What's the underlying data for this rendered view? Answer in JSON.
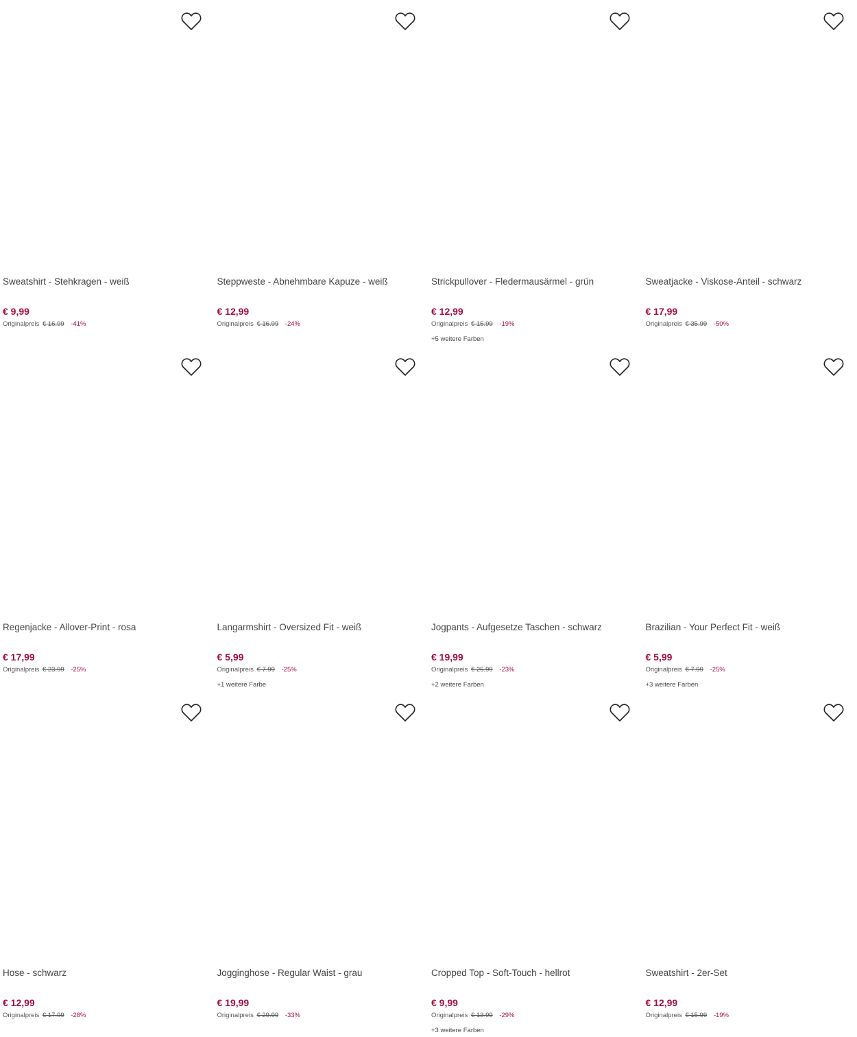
{
  "accent_color": "#a0103c",
  "wishlist_icon": "heart-outline-icon",
  "products": [
    {
      "title": "Sweatshirt - Stehkragen - weiß",
      "price": "€ 9,99",
      "orig_label": "Originalpreis",
      "orig_price": "€ 16.99",
      "discount": "-41%",
      "colors": ""
    },
    {
      "title": "Steppweste - Abnehmbare Kapuze - weiß",
      "price": "€ 12,99",
      "orig_label": "Originalpreis",
      "orig_price": "€ 16.99",
      "discount": "-24%",
      "colors": ""
    },
    {
      "title": "Strickpullover - Fledermausärmel - grün",
      "price": "€ 12,99",
      "orig_label": "Originalpreis",
      "orig_price": "€ 15.99",
      "discount": "-19%",
      "colors": "+5 weitere Farben"
    },
    {
      "title": "Sweatjacke - Viskose-Anteil - schwarz",
      "price": "€ 17,99",
      "orig_label": "Originalpreis",
      "orig_price": "€ 35.99",
      "discount": "-50%",
      "colors": ""
    },
    {
      "title": "Regenjacke - Allover-Print - rosa",
      "price": "€ 17,99",
      "orig_label": "Originalpreis",
      "orig_price": "€ 23.99",
      "discount": "-25%",
      "colors": ""
    },
    {
      "title": "Langarmshirt - Oversized Fit - weiß",
      "price": "€ 5,99",
      "orig_label": "Originalpreis",
      "orig_price": "€ 7.99",
      "discount": "-25%",
      "colors": "+1 weitere Farbe"
    },
    {
      "title": "Jogpants - Aufgesetze Taschen - schwarz",
      "price": "€ 19,99",
      "orig_label": "Originalpreis",
      "orig_price": "€ 25.99",
      "discount": "-23%",
      "colors": "+2 weitere Farben"
    },
    {
      "title": "Brazilian - Your Perfect Fit - weiß",
      "price": "€ 5,99",
      "orig_label": "Originalpreis",
      "orig_price": "€ 7.99",
      "discount": "-25%",
      "colors": "+3 weitere Farben"
    },
    {
      "title": "Hose - schwarz",
      "price": "€ 12,99",
      "orig_label": "Originalpreis",
      "orig_price": "€ 17.99",
      "discount": "-28%",
      "colors": ""
    },
    {
      "title": "Jogginghose - Regular Waist - grau",
      "price": "€ 19,99",
      "orig_label": "Originalpreis",
      "orig_price": "€ 29.99",
      "discount": "-33%",
      "colors": ""
    },
    {
      "title": "Cropped Top - Soft-Touch - hellrot",
      "price": "€ 9,99",
      "orig_label": "Originalpreis",
      "orig_price": "€ 13.99",
      "discount": "-29%",
      "colors": "+3 weitere Farben"
    },
    {
      "title": "Sweatshirt - 2er-Set",
      "price": "€ 12,99",
      "orig_label": "Originalpreis",
      "orig_price": "€ 15.99",
      "discount": "-19%",
      "colors": ""
    }
  ]
}
